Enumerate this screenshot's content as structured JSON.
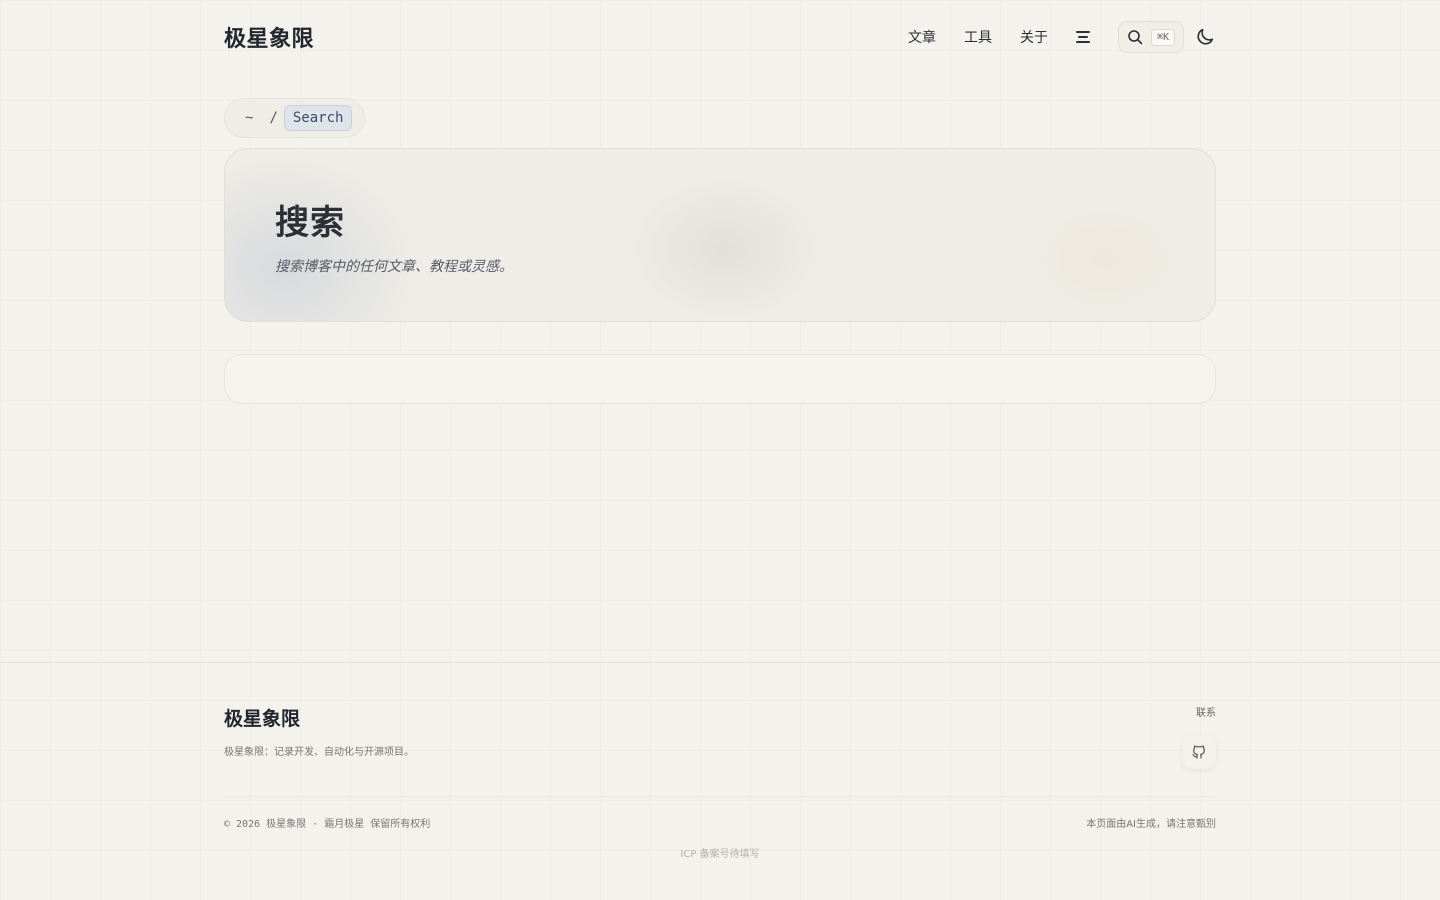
{
  "header": {
    "logo": "极星象限",
    "nav": [
      "文章",
      "工具",
      "关于"
    ],
    "search_shortcut": "⌘K"
  },
  "breadcrumb": {
    "home": "~",
    "separator": "/",
    "current": "Search"
  },
  "hero": {
    "title": "搜索",
    "subtitle": "搜索博客中的任何文章、教程或灵感。"
  },
  "search": {
    "value": "",
    "placeholder": ""
  },
  "footer": {
    "logo": "极星象限",
    "description": "极星象限：记录开发、自动化与开源项目。",
    "contact_label": "联系",
    "copyright": "© 2026 极星象限 · 霜月极星 保留所有权利",
    "ai_notice": "本页面由AI生成，请注意甄别",
    "icp": "ICP 备案号待填写"
  },
  "colors": {
    "background": "#f4f2ec",
    "text": "#2b2f36",
    "accent_tag": "#3a4d66"
  },
  "icons": {
    "menu": "menu-icon",
    "search": "search-icon",
    "theme": "moon-icon",
    "github": "github-icon"
  }
}
